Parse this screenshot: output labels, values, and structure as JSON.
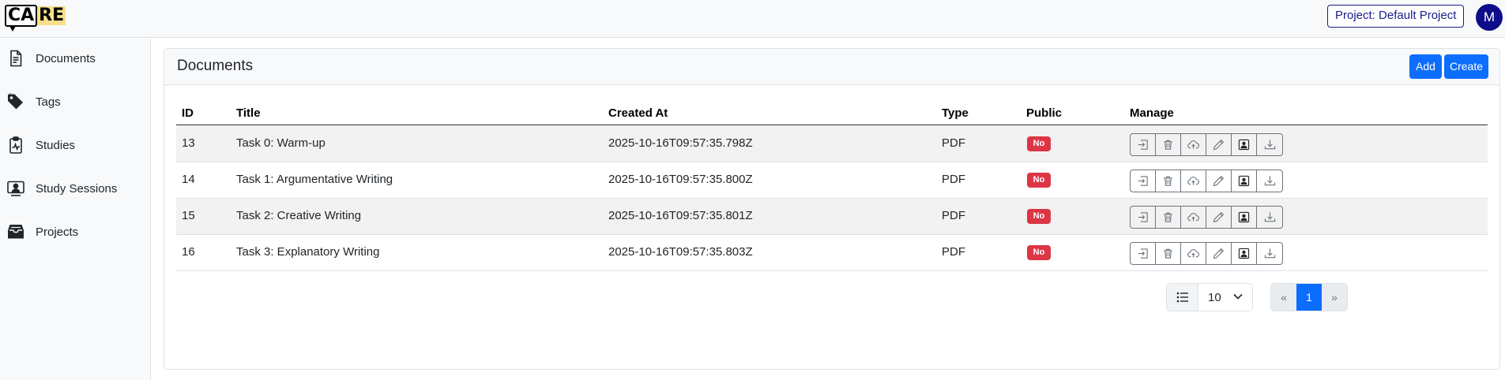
{
  "header": {
    "logo_left": "CA",
    "logo_right": "RE",
    "project_label": "Project: Default Project",
    "avatar_initial": "M"
  },
  "sidebar": {
    "items": [
      {
        "label": "Documents",
        "icon": "document-icon"
      },
      {
        "label": "Tags",
        "icon": "tag-icon"
      },
      {
        "label": "Studies",
        "icon": "clipboard-pulse-icon"
      },
      {
        "label": "Study Sessions",
        "icon": "person-screen-icon"
      },
      {
        "label": "Projects",
        "icon": "inbox-stack-icon"
      }
    ]
  },
  "main": {
    "title": "Documents",
    "add_label": "Add",
    "create_label": "Create",
    "columns": [
      "ID",
      "Title",
      "Created At",
      "Type",
      "Public",
      "Manage"
    ],
    "rows": [
      {
        "id": "13",
        "title": "Task 0: Warm-up",
        "created_at": "2025-10-16T09:57:35.798Z",
        "type": "PDF",
        "public": "No"
      },
      {
        "id": "14",
        "title": "Task 1: Argumentative Writing",
        "created_at": "2025-10-16T09:57:35.800Z",
        "type": "PDF",
        "public": "No"
      },
      {
        "id": "15",
        "title": "Task 2: Creative Writing",
        "created_at": "2025-10-16T09:57:35.801Z",
        "type": "PDF",
        "public": "No"
      },
      {
        "id": "16",
        "title": "Task 3: Explanatory Writing",
        "created_at": "2025-10-16T09:57:35.803Z",
        "type": "PDF",
        "public": "No"
      }
    ],
    "manage_actions": [
      "enter-icon",
      "trash-icon",
      "cloud-upload-icon",
      "pencil-icon",
      "person-badge-icon",
      "download-icon"
    ]
  },
  "pagination": {
    "page_size": "10",
    "prev": "«",
    "current_page": "1",
    "next": "»"
  },
  "colors": {
    "primary": "#0d6efd",
    "danger": "#dc3545",
    "project_border": "#1d1c8a",
    "avatar_bg": "#0d0d8a"
  }
}
